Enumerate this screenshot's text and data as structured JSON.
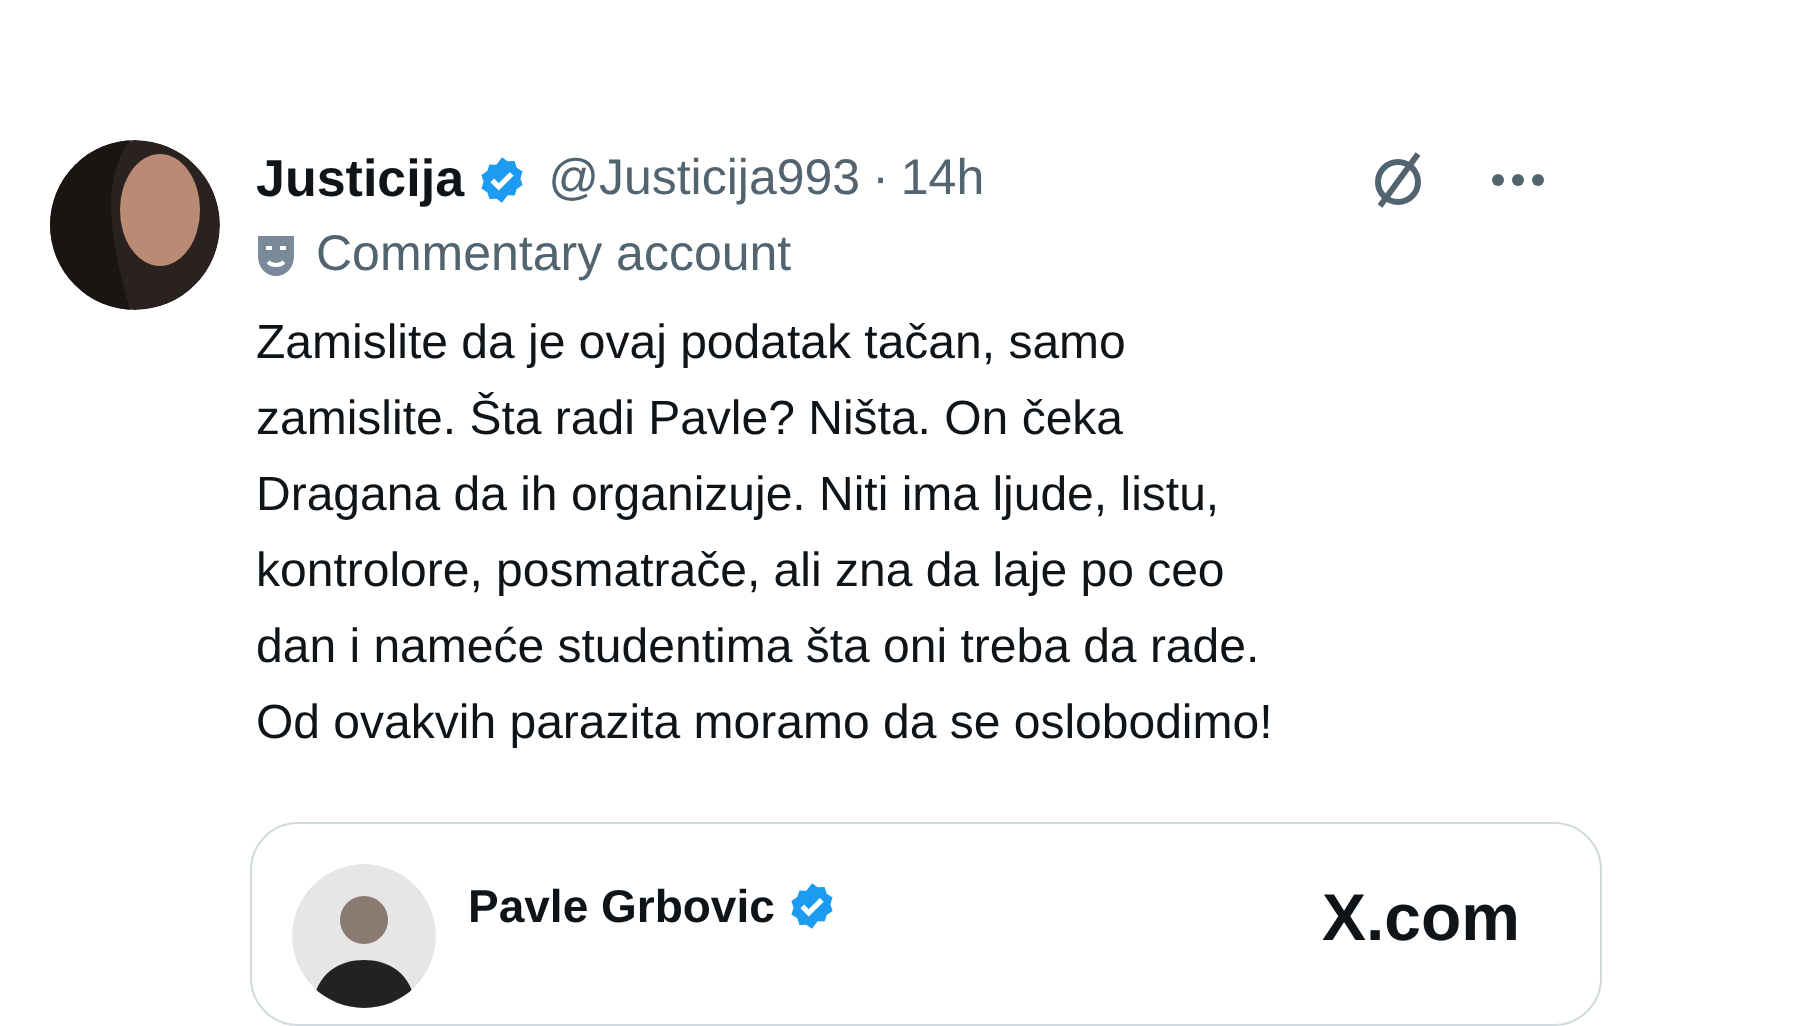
{
  "tweet": {
    "author": {
      "name": "Justicija",
      "verified": true,
      "handle": "@Justicija993",
      "separator": "·",
      "time": "14h"
    },
    "label": "Commentary account",
    "body_lines": [
      "Zamislite da je ovaj podatak tačan, samo",
      "zamislite. Šta radi Pavle? Ništa. On čeka",
      "Dragana da ih organizuje. Niti ima ljude, listu,",
      "kontrolore, posmatrače, ali zna da laje po ceo",
      "dan i nameće studentima šta oni treba da rade.",
      "Od ovakvih parazita moramo da se oslobodimo!"
    ],
    "quote": {
      "name": "Pavle Grbovic",
      "verified": true,
      "source": "X.com"
    }
  }
}
